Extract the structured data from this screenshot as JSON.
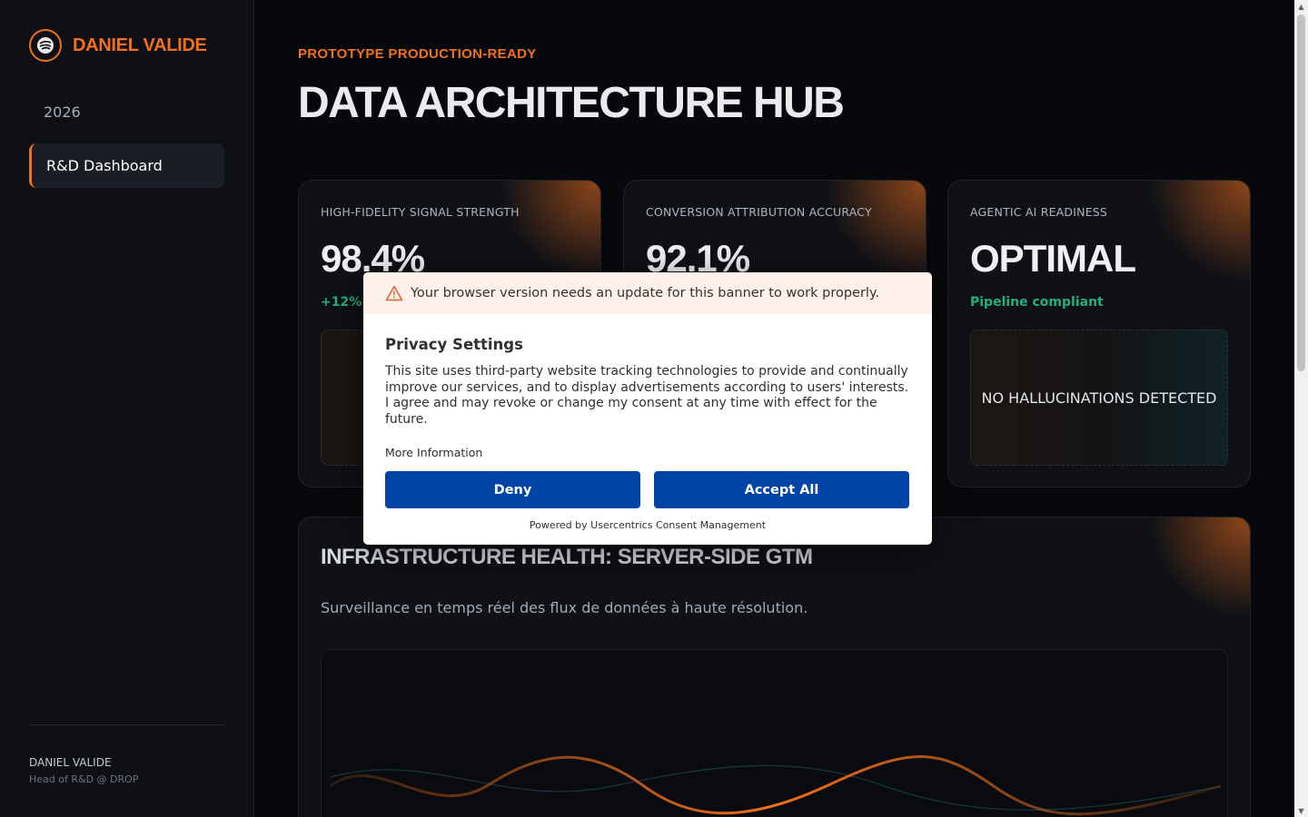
{
  "sidebar": {
    "brand_name": "DANIEL VALIDE",
    "nav": {
      "year": "2026",
      "active": "R&D Dashboard"
    },
    "user": {
      "name": "DANIEL VALIDE",
      "role": "Head of R&D @ DROP"
    }
  },
  "header": {
    "eyebrow": "PROTOTYPE PRODUCTION-READY",
    "title": "DATA ARCHITECTURE HUB"
  },
  "cards": [
    {
      "label": "HIGH-FIDELITY SIGNAL STRENGTH",
      "value": "98.4%",
      "sub": "+12% v"
    },
    {
      "label": "CONVERSION ATTRIBUTION ACCURACY",
      "value": "92.1%",
      "sub": ""
    },
    {
      "label": "AGENTIC AI READINESS",
      "value": "OPTIMAL",
      "sub": "Pipeline compliant",
      "panel": "NO HALLUCINATIONS DETECTED"
    }
  ],
  "infra": {
    "title": "INFRASTRUCTURE HEALTH: SERVER-SIDE GTM",
    "description": "Surveillance en temps réel des flux de données à haute résolution."
  },
  "consent": {
    "warning": "Your browser version needs an update for this banner to work properly.",
    "title": "Privacy Settings",
    "body": "This site uses third-party website tracking technologies to provide and continually improve our services, and to display advertisements according to users' interests. I agree and may revoke or change my consent at any time with effect for the future.",
    "more_info": "More Information",
    "deny_label": "Deny",
    "accept_label": "Accept All",
    "footer": "Powered by Usercentrics Consent Management"
  },
  "colors": {
    "accent": "#f0701d",
    "positive": "#22b07d",
    "consent_button": "#0045a5"
  },
  "icons": [
    "logo-icon",
    "warning-icon",
    "scroll-up-icon",
    "scroll-down-icon"
  ]
}
